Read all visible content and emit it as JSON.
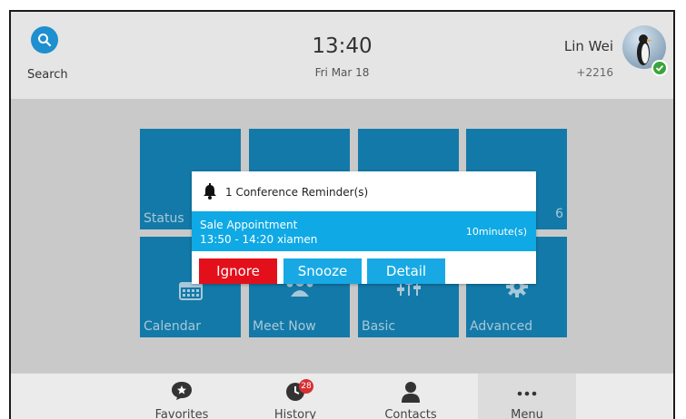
{
  "header": {
    "search_label": "Search",
    "time": "13:40",
    "date": "Fri Mar 18",
    "user_name": "Lin Wei",
    "user_number": "+2216"
  },
  "tiles": {
    "status": "Status",
    "tile_top_right_partial": "6",
    "calendar": "Calendar",
    "meet_now": "Meet Now",
    "basic": "Basic",
    "advanced": "Advanced"
  },
  "dialog": {
    "title": "1 Conference Reminder(s)",
    "reminder_title": "Sale Appointment",
    "reminder_time": "13:50 - 14:20 xiamen",
    "reminder_remaining": "10minute(s)",
    "ignore_label": "Ignore",
    "snooze_label": "Snooze",
    "detail_label": "Detail"
  },
  "bottom_nav": {
    "favorites": "Favorites",
    "history": "History",
    "history_badge": "28",
    "contacts": "Contacts",
    "menu": "Menu"
  },
  "colors": {
    "accent_blue": "#0fa9e5",
    "tile_blue": "#1379a8",
    "ignore_red": "#e3101c"
  }
}
